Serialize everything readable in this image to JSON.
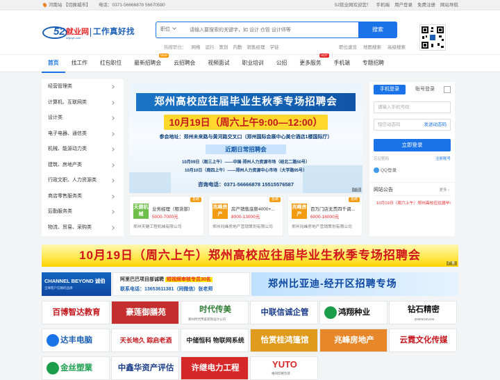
{
  "topbar": {
    "location": "河南站",
    "switch_city": "【切换城市】",
    "phone": "电话：0371-56666878 56670580",
    "welcome": "52就业网欢迎您！",
    "links": [
      "手机端",
      "用户登录",
      "免费注册",
      "网站导航"
    ]
  },
  "header": {
    "logo": {
      "num": "52",
      "job": "就业网",
      "slogan": "工作真好找",
      "sub": "52jiuye.com"
    },
    "search": {
      "category": "职位",
      "placeholder": "请输入要搜索的关键字，如 设计 仓管 设计师等",
      "button": "搜索"
    },
    "hot": {
      "label": "热搜职位：",
      "items": [
        "网络",
        "运行",
        "策划",
        "内勤",
        "销售经理",
        "学徒"
      ]
    },
    "extra_links": [
      "职位速览",
      "地图搜索",
      "高级搜索"
    ]
  },
  "nav": {
    "items": [
      {
        "label": "首页",
        "active": true
      },
      {
        "label": "找工作"
      },
      {
        "label": "红包职位"
      },
      {
        "label": "最新招聘会",
        "badge": "NEW"
      },
      {
        "label": "云招聘会"
      },
      {
        "label": "视频面试"
      },
      {
        "label": "职业培训"
      },
      {
        "label": "公招"
      },
      {
        "label": "更多服务",
        "badge": "HOT"
      },
      {
        "label": "手机端"
      },
      {
        "label": "专题招聘"
      }
    ]
  },
  "sidebar": {
    "items": [
      "经营管理类",
      "计算机、互联网类",
      "设计类",
      "电子电器、通信类",
      "机械、能源动力类",
      "建筑、房地产类",
      "行政文职、人力资源类",
      "商店零售服务类",
      "后勤服务类",
      "物流、贸易、采购类"
    ]
  },
  "banner": {
    "title": "郑州高校应往届毕业生秋季专场招聘会",
    "date": "10月19日（周六上午9:00—12:00）",
    "address": "参会地址：郑州未来路与黄河路交叉口（郑州国际会展中心美仑酒店1楼国际厅）",
    "subtitle": "近期日常招聘会",
    "line1": "10月09日（周三上午）——中国·郑州人力资源市场（经北二路50号）",
    "line2": "10月10日（周四上午）——郑州人力资源中心市场（大学路95号）",
    "phone": "咨询电话：0371-56666878  15515576587",
    "ad_tag": "广告"
  },
  "jobs": [
    {
      "logo": "天健机械",
      "title": "业务经理（租赁部）",
      "salary": "5000-7000元",
      "company": "郑州天健工程机械有限公司",
      "pin": "急聘",
      "color": "#6fbf4a"
    },
    {
      "logo": "兆峰房产",
      "title": "房产销售底薪4000+...",
      "salary": "8000-13000元",
      "company": "郑州兆峰房地产营销策划有限公司",
      "pin": "急聘",
      "color": "#f39c12"
    },
    {
      "logo": "兆峰房产",
      "title": "百万门店无责四千调...",
      "salary": "6000-16000元",
      "company": "郑州兆峰房地产营销策划有限公司",
      "pin": "急聘",
      "color": "#f39c12"
    }
  ],
  "login": {
    "tab_phone": "手机登录",
    "tab_account": "账号登录",
    "phone_placeholder": "请输入手机号码",
    "code_placeholder": "短信动态码",
    "send_code": "发送动态码",
    "submit": "立即登录",
    "forgot": "忘记密码",
    "register": "注册账号",
    "qq": "QQ登录"
  },
  "notice": {
    "title": "网站公告",
    "more": "更多",
    "items": [
      "10月19日（周六上午）郑州高校应往届毕业生秋季专场招聘会"
    ]
  },
  "wide_banner": {
    "text": "10月19日（周六上午）郑州高校应往届毕业生秋季专场招聘会",
    "ad_tag": "广告"
  },
  "row2": {
    "a": {
      "title": "CHANNEL BEYOND 诚伯",
      "sub": "全球客户信赖的品牌"
    },
    "b": {
      "line1_prefix": "阿里巴巴项目部诚聘",
      "line1_highlight": "短视频审核专员30名",
      "line2": "联系电话：13653611381（同微信）张老师"
    },
    "c": {
      "title": "郑州比亚迪-经开区招聘专场"
    }
  },
  "row3": [
    {
      "text": "百博智达教育",
      "color": "#c4161c"
    },
    {
      "text": "豪莲御膳苑",
      "color": "#fff",
      "bg": "#c42e2e"
    },
    {
      "text": "时代传美",
      "color": "#2e7d32",
      "sub": "郑州时代传美装饰设计公司"
    },
    {
      "text": "中联信诚企管",
      "color": "#1a3c8a"
    },
    {
      "text": "鸿翔种业",
      "color": "#111",
      "icon": "#1a9e4b"
    },
    {
      "text": "钻石精密",
      "color": "#111",
      "sub": "ZHENGZUAN"
    }
  ],
  "row4": [
    {
      "text": "达丰电脑",
      "color": "#1a5fb4",
      "icon": "#1a73e8"
    },
    {
      "text": "天长地久 踪启老酒",
      "color": "#c4161c"
    },
    {
      "text": "中储恒科 物联网系统",
      "color": "#222"
    },
    {
      "text": "恰赏桂鸿篷馆",
      "color": "#fff",
      "bg": "#e09a1c"
    },
    {
      "text": "兆峰房地产",
      "color": "#fff",
      "bg": "#e8872a"
    },
    {
      "text": "云霓文化传媒",
      "color": "#c4161c"
    }
  ],
  "row5": [
    {
      "text": "金丝塑業",
      "color": "#1a9e4b",
      "icon": "#1a9e4b"
    },
    {
      "text": "中鑫华资产评估",
      "color": "#1a3c8a"
    },
    {
      "text": "许继电力工程",
      "color": "#fff",
      "bg": "#d62828"
    },
    {
      "text": "YUTO",
      "color": "#d62828",
      "sub": "裕同印刷包装"
    }
  ],
  "colors": {
    "brand": "#1a73e8",
    "accent": "#e8272a"
  }
}
